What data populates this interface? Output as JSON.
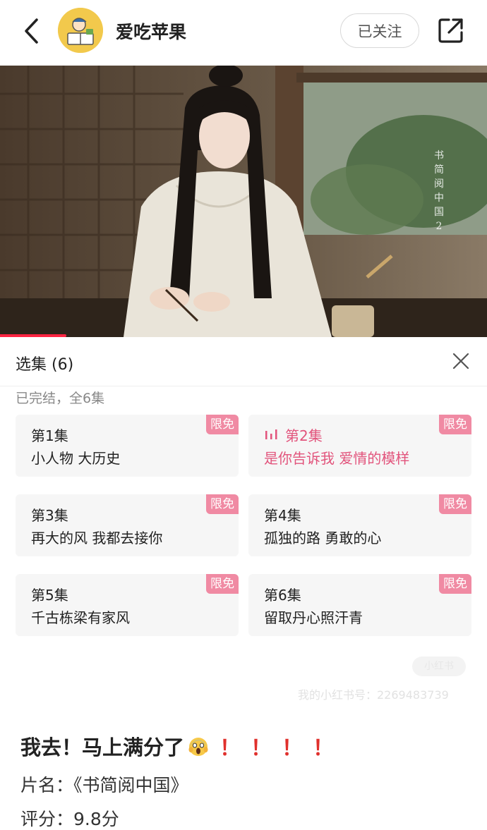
{
  "header": {
    "username": "爱吃苹果",
    "follow_label": "已关注",
    "icons": [
      "back-icon",
      "avatar",
      "share-icon"
    ]
  },
  "video": {
    "watermark_text": "书简阅中国2",
    "progress": 0.136
  },
  "episodes_panel": {
    "title": "选集 (6)",
    "status": "已完结，全6集",
    "badge_label": "限免",
    "items": [
      {
        "num": "第1集",
        "name": "小人物 大历史",
        "active": false
      },
      {
        "num": "第2集",
        "name": "是你告诉我 爱情的模样",
        "active": true
      },
      {
        "num": "第3集",
        "name": "再大的风 我都去接你",
        "active": false
      },
      {
        "num": "第4集",
        "name": "孤独的路 勇敢的心",
        "active": false
      },
      {
        "num": "第5集",
        "name": "千古栋梁有家风",
        "active": false
      },
      {
        "num": "第6集",
        "name": "留取丹心照汗青",
        "active": false
      }
    ],
    "active_color": "#e2547c",
    "badge_color": "#f08aa3"
  },
  "watermarks": {
    "small": "小红书",
    "id_text": "我的小红书号：2269483739"
  },
  "post": {
    "title": "我去！马上满分了",
    "exclamations": [
      "！",
      "！",
      "！",
      "！"
    ],
    "film_line": "片名：《书简阅中国》",
    "score_line": "评分：9.8分"
  }
}
